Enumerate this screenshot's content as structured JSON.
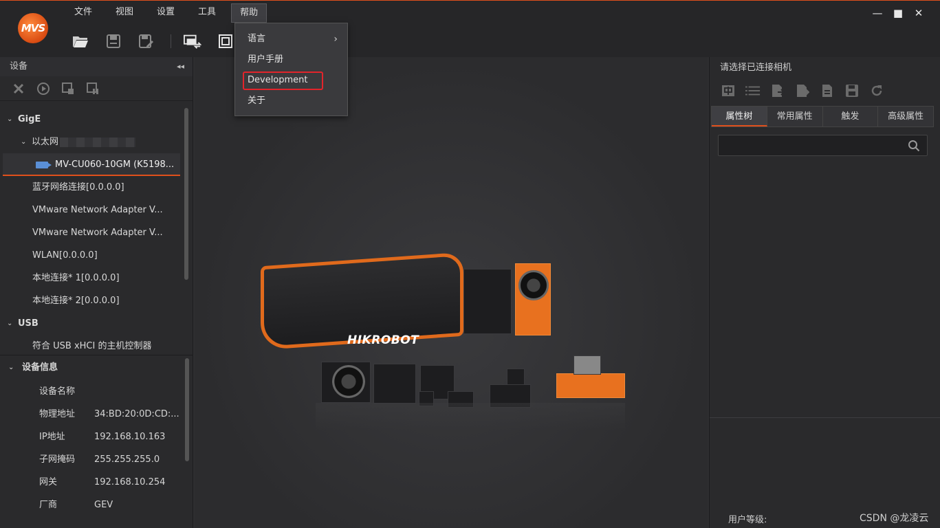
{
  "app": {
    "logo_text": "MVS"
  },
  "menubar": {
    "items": [
      "文件",
      "视图",
      "设置",
      "工具",
      "帮助"
    ],
    "active": "帮助"
  },
  "toolbar": {
    "icons": [
      "open-folder-icon",
      "save-icon",
      "save-as-icon",
      "switch-layout-icon",
      "fullscreen-icon"
    ]
  },
  "window_controls": {
    "minimize": "—",
    "maximize": "■",
    "close": "✕"
  },
  "help_menu": {
    "items": [
      {
        "label": "语言",
        "has_submenu": true,
        "submenu_arrow": "›"
      },
      {
        "label": "用户手册",
        "has_submenu": false
      },
      {
        "label": "Development",
        "has_submenu": false,
        "highlighted": true
      },
      {
        "label": "关于",
        "has_submenu": false
      }
    ]
  },
  "left_panel": {
    "title": "设备",
    "collapse_glyph": "◂◂",
    "tree": {
      "gige_label": "GigE",
      "ethernet_label": "以太网",
      "selected_device": "MV-CU060-10GM (K5198...",
      "adapters": [
        "蓝牙网络连接[0.0.0.0]",
        "VMware Network Adapter V...",
        "VMware Network Adapter V...",
        "WLAN[0.0.0.0]",
        "本地连接* 1[0.0.0.0]",
        "本地连接* 2[0.0.0.0]"
      ],
      "usb_label": "USB",
      "usb_controller": "符合 USB xHCI 的主机控制器"
    },
    "device_info": {
      "title": "设备信息",
      "rows": [
        {
          "key": "设备名称",
          "value": ""
        },
        {
          "key": "物理地址",
          "value": "34:BD:20:0D:CD:..."
        },
        {
          "key": "IP地址",
          "value": "192.168.10.163"
        },
        {
          "key": "子网掩码",
          "value": "255.255.255.0"
        },
        {
          "key": "网关",
          "value": "192.168.10.254"
        },
        {
          "key": "厂商",
          "value": "GEV"
        }
      ]
    }
  },
  "center": {
    "brand_text": "HIKROBOT"
  },
  "right_panel": {
    "title": "请选择已连接相机",
    "tabs": [
      "属性树",
      "常用属性",
      "触发",
      "高级属性"
    ],
    "active_tab": "属性树",
    "search_placeholder": "",
    "user_level_label": "用户等级:"
  },
  "watermark": "CSDN @龙凌云",
  "colors": {
    "accent": "#e0501c",
    "highlight_box": "#e3242b",
    "background": "#2b2b2d"
  }
}
